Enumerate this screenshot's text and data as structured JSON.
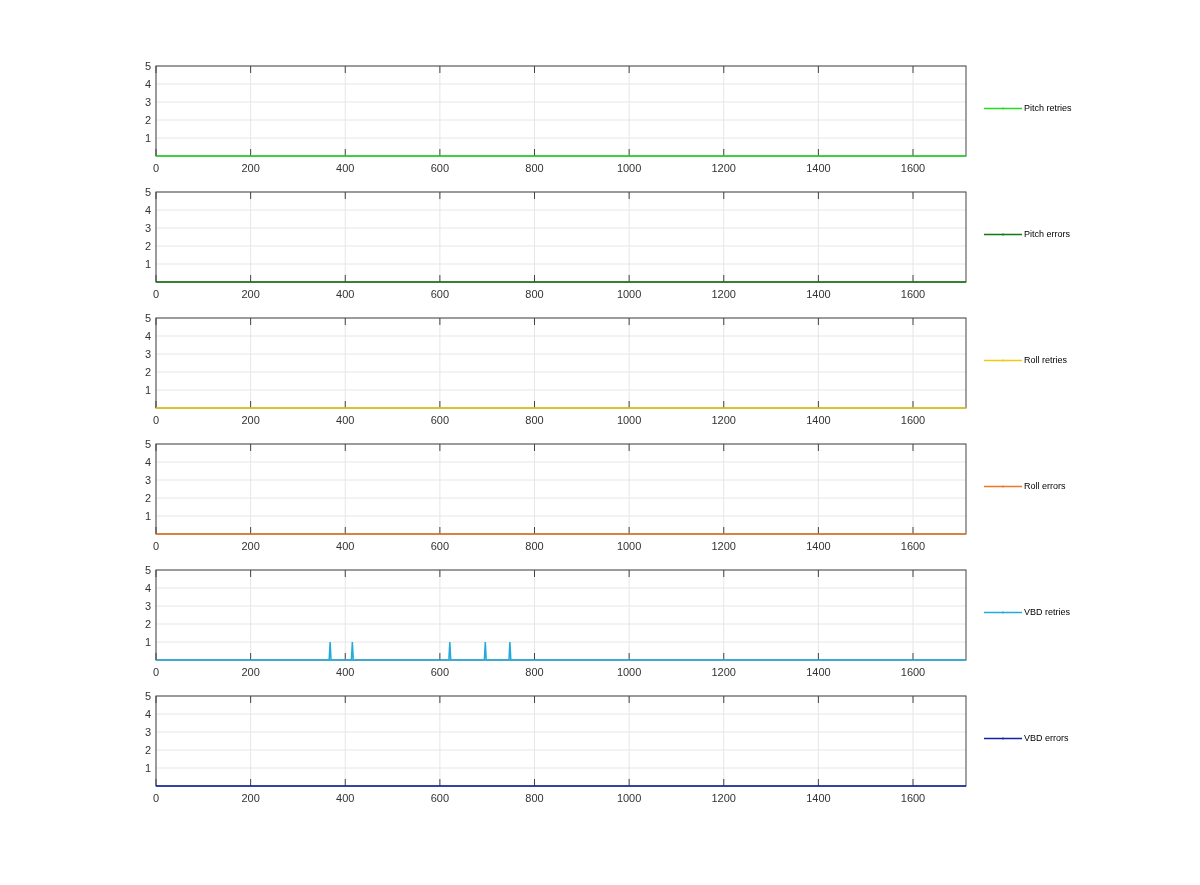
{
  "subplots": [
    {
      "chart_data": {
        "type": "line",
        "grid": true,
        "x": [
          0,
          1712
        ],
        "series": [
          {
            "name": "Pitch retries",
            "color": "#22dd22",
            "values": [
              0,
              0
            ]
          }
        ],
        "xlim": [
          0,
          1712
        ],
        "ylim": [
          0,
          5
        ],
        "xticks": [
          0,
          200,
          400,
          600,
          800,
          1000,
          1200,
          1400,
          1600
        ],
        "yticks": [
          1,
          2,
          3,
          4,
          5
        ]
      }
    },
    {
      "chart_data": {
        "type": "line",
        "grid": true,
        "x": [
          0,
          1712
        ],
        "series": [
          {
            "name": "Pitch errors",
            "color": "#117711",
            "values": [
              0,
              0
            ]
          }
        ],
        "xlim": [
          0,
          1712
        ],
        "ylim": [
          0,
          5
        ],
        "xticks": [
          0,
          200,
          400,
          600,
          800,
          1000,
          1200,
          1400,
          1600
        ],
        "yticks": [
          1,
          2,
          3,
          4,
          5
        ]
      }
    },
    {
      "chart_data": {
        "type": "line",
        "grid": true,
        "x": [
          0,
          1712
        ],
        "series": [
          {
            "name": "Roll retries",
            "color": "#eecc11",
            "values": [
              0,
              0
            ]
          }
        ],
        "xlim": [
          0,
          1712
        ],
        "ylim": [
          0,
          5
        ],
        "xticks": [
          0,
          200,
          400,
          600,
          800,
          1000,
          1200,
          1400,
          1600
        ],
        "yticks": [
          1,
          2,
          3,
          4,
          5
        ]
      }
    },
    {
      "chart_data": {
        "type": "line",
        "grid": true,
        "x": [
          0,
          1712
        ],
        "series": [
          {
            "name": "Roll errors",
            "color": "#ee7722",
            "values": [
              0,
              0
            ]
          }
        ],
        "xlim": [
          0,
          1712
        ],
        "ylim": [
          0,
          5
        ],
        "xticks": [
          0,
          200,
          400,
          600,
          800,
          1000,
          1200,
          1400,
          1600
        ],
        "yticks": [
          1,
          2,
          3,
          4,
          5
        ]
      }
    },
    {
      "chart_data": {
        "type": "line",
        "grid": true,
        "x": [
          0,
          366,
          368,
          370,
          413,
          415,
          417,
          619,
          621,
          623,
          694,
          696,
          698,
          746,
          748,
          750,
          1712
        ],
        "series": [
          {
            "name": "VBD retries",
            "color": "#22aadd",
            "values": [
              0,
              0,
              1,
              0,
              0,
              1,
              0,
              0,
              1,
              0,
              0,
              1,
              0,
              0,
              1,
              0,
              0
            ]
          }
        ],
        "xlim": [
          0,
          1712
        ],
        "ylim": [
          0,
          5
        ],
        "xticks": [
          0,
          200,
          400,
          600,
          800,
          1000,
          1200,
          1400,
          1600
        ],
        "yticks": [
          1,
          2,
          3,
          4,
          5
        ]
      }
    },
    {
      "chart_data": {
        "type": "line",
        "grid": true,
        "x": [
          0,
          1712
        ],
        "series": [
          {
            "name": "VBD errors",
            "color": "#1122aa",
            "values": [
              0,
              0
            ]
          }
        ],
        "xlim": [
          0,
          1712
        ],
        "ylim": [
          0,
          5
        ],
        "xticks": [
          0,
          200,
          400,
          600,
          800,
          1000,
          1200,
          1400,
          1600
        ],
        "yticks": [
          1,
          2,
          3,
          4,
          5
        ]
      }
    }
  ]
}
